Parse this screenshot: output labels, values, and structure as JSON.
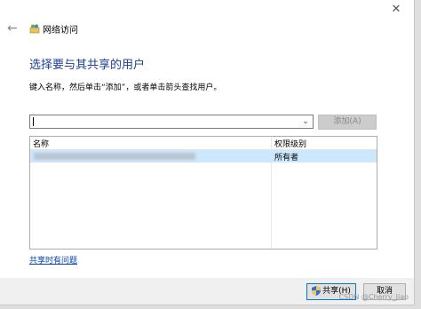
{
  "window": {
    "title": "网络访问",
    "close_glyph": "✕",
    "back_glyph": "←"
  },
  "main": {
    "heading": "选择要与其共享的用户",
    "instruction": "键入名称，然后单击“添加”，或者单击箭头查找用户。",
    "combo_value": "",
    "add_label": "添加(A)"
  },
  "table": {
    "columns": [
      "名称",
      "权限级别"
    ],
    "rows": [
      {
        "name": "",
        "permission": "所有者"
      }
    ]
  },
  "help_link": "共享时有问题",
  "footer": {
    "share_label": "共享(H)",
    "cancel_label": "取消"
  },
  "watermark": "CSDN @Cherry_Jiao",
  "colors": {
    "heading": "#1e3f94",
    "selected_row": "#cce8ff",
    "link": "#0645ad",
    "focus_border": "#0078d7"
  }
}
